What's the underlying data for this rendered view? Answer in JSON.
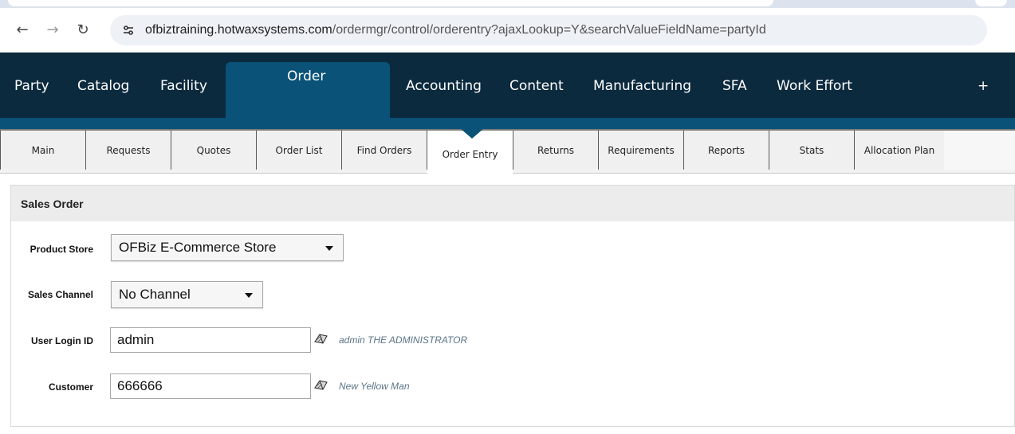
{
  "browser": {
    "url_host": "ofbiztraining.hotwaxsystems.com",
    "url_path": "/ordermgr/control/orderentry?ajaxLookup=Y&searchValueFieldName=partyId",
    "icons": {
      "back": "arrow-left-icon",
      "forward": "arrow-right-icon",
      "reload": "reload-icon",
      "site_info": "tune-icon"
    }
  },
  "topnav": {
    "items": [
      {
        "label": "Party"
      },
      {
        "label": "Catalog"
      },
      {
        "label": "Facility"
      },
      {
        "label": "Order"
      },
      {
        "label": "Accounting"
      },
      {
        "label": "Content"
      },
      {
        "label": "Manufacturing"
      },
      {
        "label": "SFA"
      },
      {
        "label": "Work Effort"
      },
      {
        "label": "+"
      }
    ],
    "active": "Order",
    "colors": {
      "bg": "#0c2a3e",
      "active": "#0a5278"
    }
  },
  "subnav": {
    "tabs": [
      {
        "label": "Main"
      },
      {
        "label": "Requests"
      },
      {
        "label": "Quotes"
      },
      {
        "label": "Order List"
      },
      {
        "label": "Find Orders"
      },
      {
        "label": "Order Entry"
      },
      {
        "label": "Returns"
      },
      {
        "label": "Requirements"
      },
      {
        "label": "Reports"
      },
      {
        "label": "Stats"
      },
      {
        "label": "Allocation Plan"
      }
    ],
    "active": "Order Entry"
  },
  "form": {
    "title": "Sales Order",
    "product_store": {
      "label": "Product Store",
      "value": "OFBiz E-Commerce Store"
    },
    "sales_channel": {
      "label": "Sales Channel",
      "value": "No Channel"
    },
    "user_login": {
      "label": "User Login ID",
      "value": "admin",
      "description": "admin THE ADMINISTRATOR"
    },
    "customer": {
      "label": "Customer",
      "value": "666666",
      "description": "New Yellow Man"
    }
  }
}
